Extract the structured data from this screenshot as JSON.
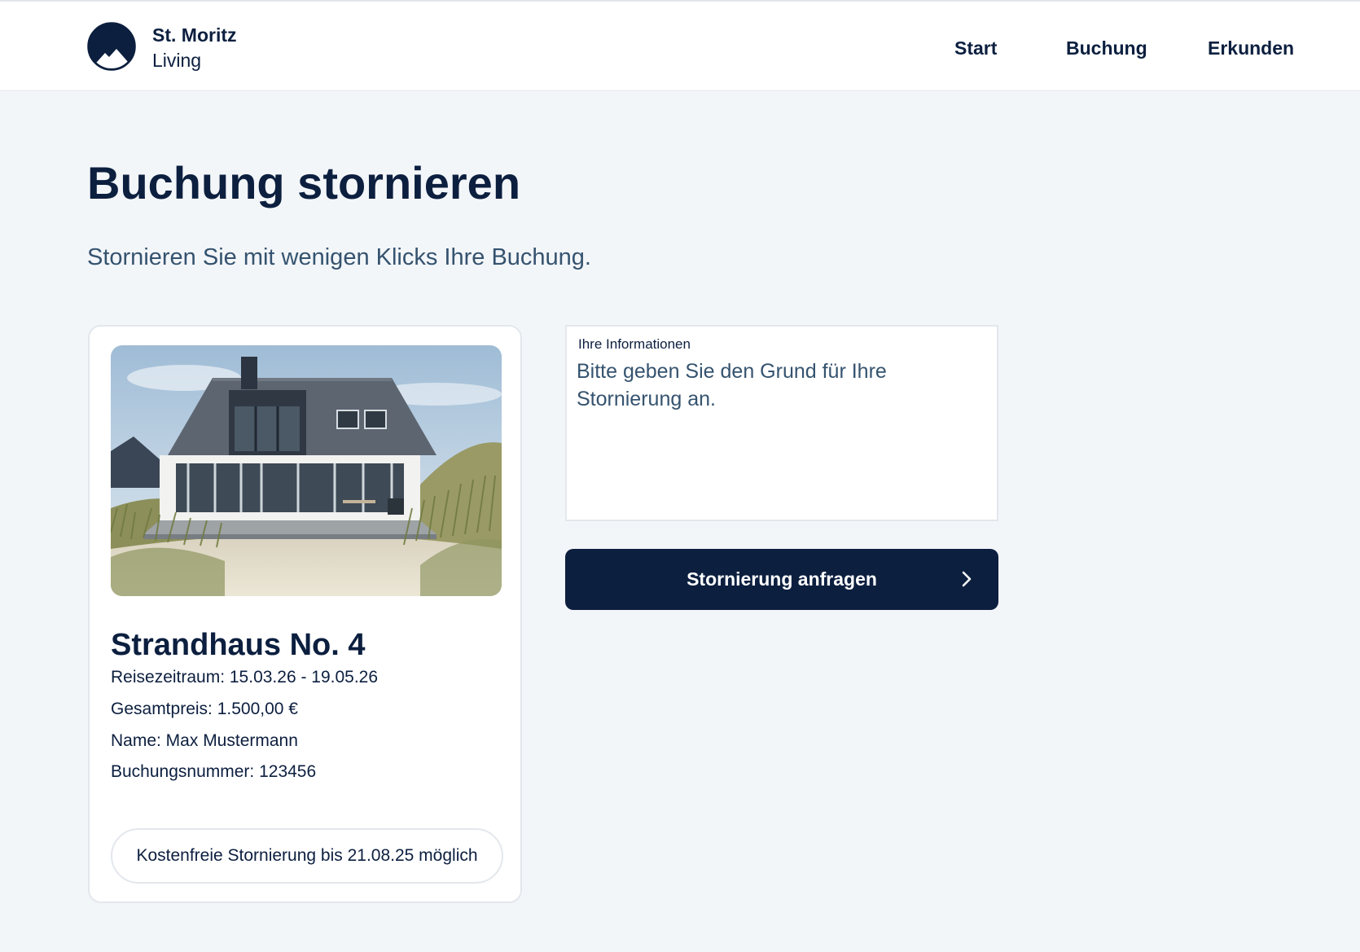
{
  "header": {
    "brand_line1": "St. Moritz",
    "brand_line2": "Living",
    "nav": [
      {
        "label": "Start"
      },
      {
        "label": "Buchung"
      },
      {
        "label": "Erkunden"
      }
    ]
  },
  "page": {
    "title": "Buchung stornieren",
    "subtitle": "Stornieren Sie mit wenigen Klicks Ihre Buchung."
  },
  "booking": {
    "image_icon": "beach-house-photo",
    "name": "Strandhaus No. 4",
    "details": [
      "Reisezeitraum: 15.03.26 - 19.05.26",
      "Gesamtpreis: 1.500,00 €",
      "Name: Max Mustermann",
      "Buchungsnummer: 123456"
    ],
    "free_cancel_note": "Kostenfreie Stornierung bis 21.08.25 möglich"
  },
  "form": {
    "label": "Ihre Informationen",
    "placeholder": "Bitte geben Sie den Grund für Ihre Stornierung an.",
    "value": "",
    "submit_label": "Stornierung anfragen",
    "submit_icon": "chevron-right-icon"
  },
  "colors": {
    "brand_navy": "#0c1f3f",
    "page_bg": "#f3f6f9",
    "muted_text": "#35536f",
    "border": "#e3e7ec"
  }
}
